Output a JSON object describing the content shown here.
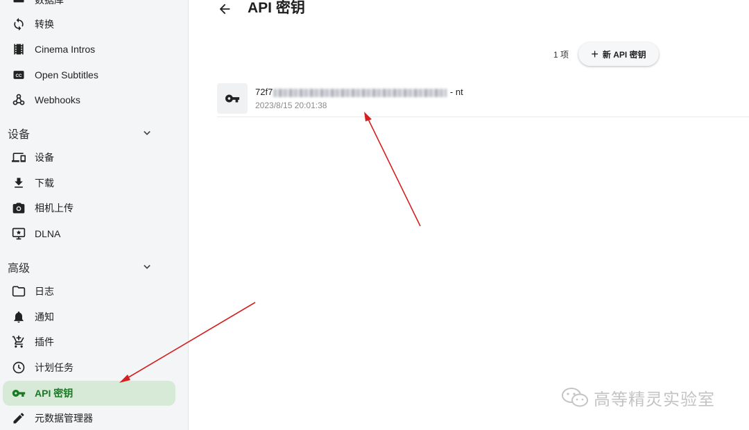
{
  "sidebar": {
    "top_items": [
      {
        "label": "数据库",
        "icon": "database-icon"
      },
      {
        "label": "转换",
        "icon": "sync-icon"
      },
      {
        "label": "Cinema Intros",
        "icon": "film-icon"
      },
      {
        "label": "Open Subtitles",
        "icon": "closed-caption-icon"
      },
      {
        "label": "Webhooks",
        "icon": "webhook-icon"
      }
    ],
    "sections": [
      {
        "title": "设备",
        "items": [
          {
            "label": "设备",
            "icon": "devices-icon"
          },
          {
            "label": "下载",
            "icon": "download-icon"
          },
          {
            "label": "相机上传",
            "icon": "camera-icon"
          },
          {
            "label": "DLNA",
            "icon": "dlna-icon"
          }
        ]
      },
      {
        "title": "高级",
        "items": [
          {
            "label": "日志",
            "icon": "folder-icon"
          },
          {
            "label": "通知",
            "icon": "bell-icon"
          },
          {
            "label": "插件",
            "icon": "cart-icon"
          },
          {
            "label": "计划任务",
            "icon": "clock-icon"
          },
          {
            "label": "API 密钥",
            "icon": "key-icon",
            "active": true
          },
          {
            "label": "元数据管理器",
            "icon": "pencil-icon"
          }
        ]
      }
    ]
  },
  "header": {
    "title": "API 密钥",
    "back_icon": "arrow-back-icon"
  },
  "toolbar": {
    "count": "1 项",
    "new_button_label": "新 API 密钥",
    "new_button_icon": "plus-icon"
  },
  "api_keys": [
    {
      "key_prefix": "72f7",
      "key_suffix": " - nt",
      "date": "2023/8/15 20:01:38",
      "icon": "key-icon"
    }
  ],
  "watermark": {
    "text": "高等精灵实验室",
    "icon": "wechat-icon"
  },
  "colors": {
    "accent": "#1a7a24",
    "active_bg": "#d7ead8",
    "sidebar_bg": "#f4f5f6",
    "annotation_arrow": "#d42020"
  }
}
